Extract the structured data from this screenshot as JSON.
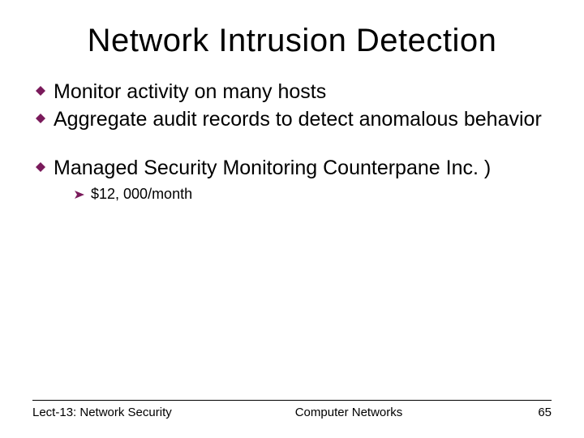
{
  "title": "Network Intrusion Detection",
  "bullets": {
    "b0": "Monitor activity on many hosts",
    "b1": "Aggregate audit records to detect anomalous behavior",
    "b2": "Managed Security Monitoring Counterpane Inc. )"
  },
  "sub": {
    "s0": "$12, 000/month"
  },
  "footer": {
    "left": "Lect-13: Network Security",
    "center": "Computer Networks",
    "page": "65"
  }
}
